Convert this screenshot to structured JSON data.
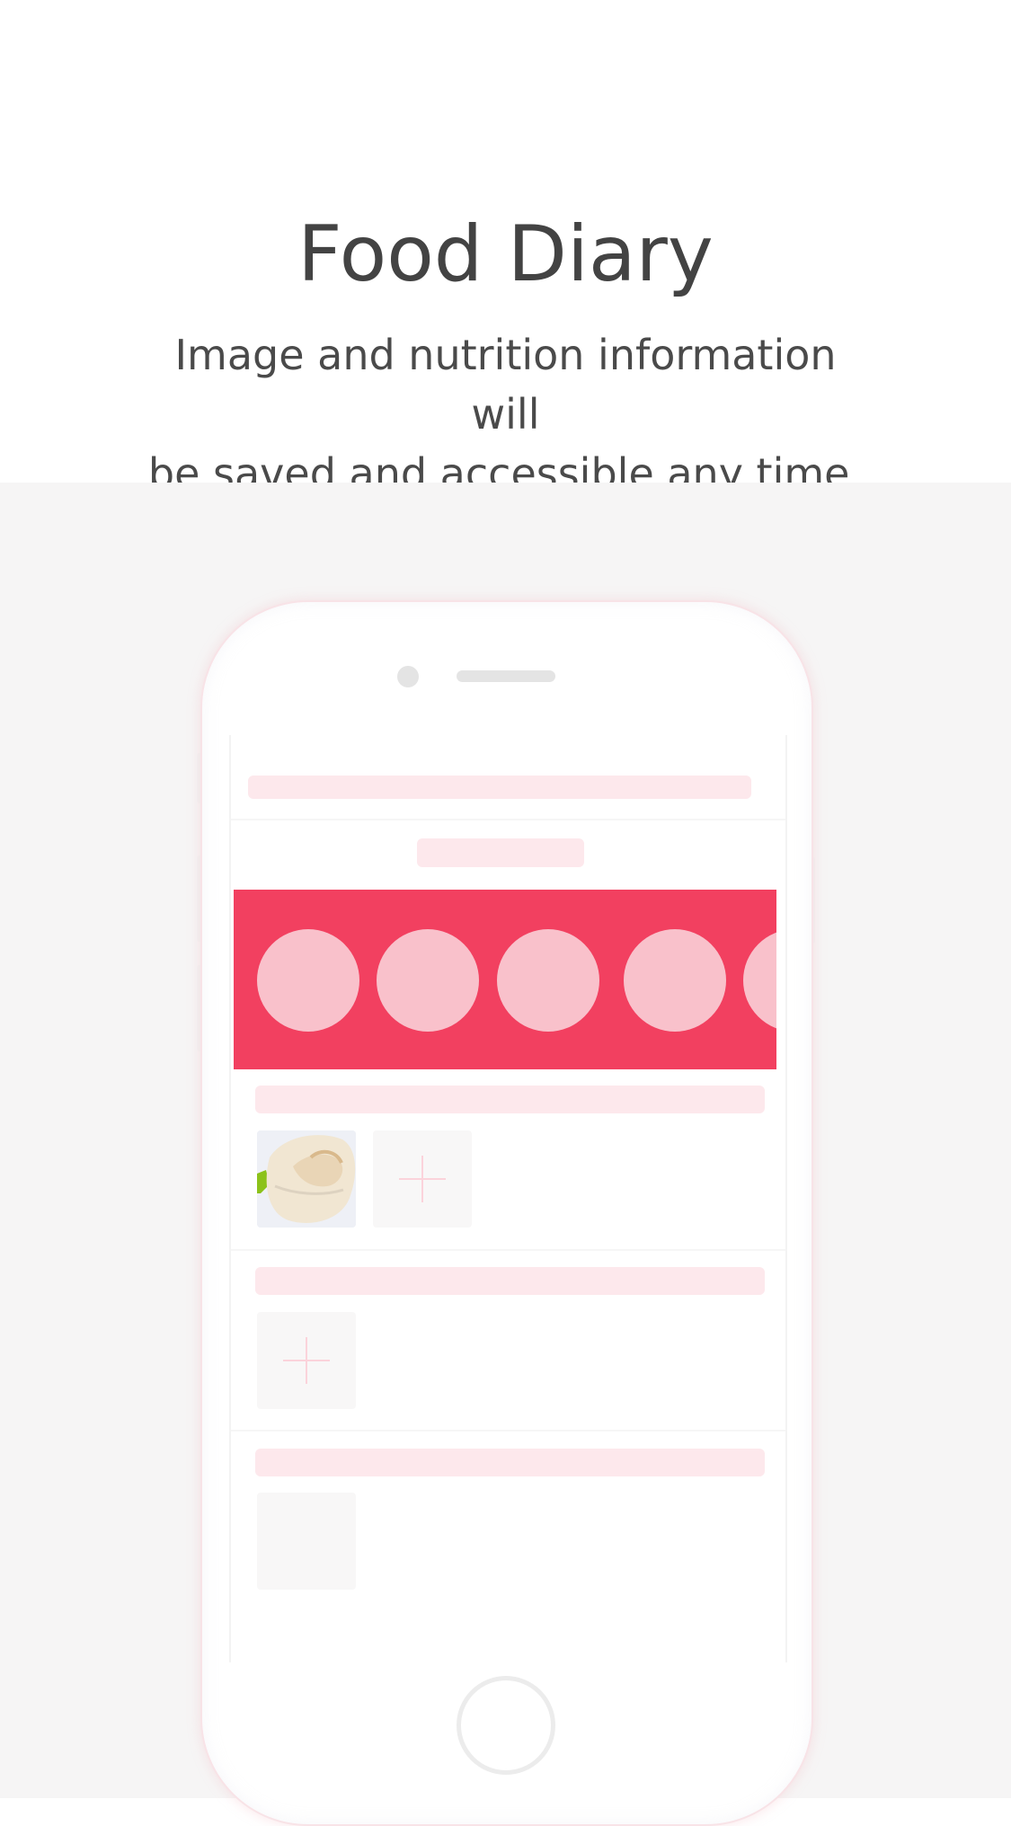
{
  "header": {
    "title": "Food Diary",
    "subtitle_line1": "Image and nutrition information will",
    "subtitle_line2": "be saved and accessible any time."
  },
  "colors": {
    "accent": "#f24060",
    "placeholder_pink": "#fde8ec",
    "circle_pink": "#f9c1cb",
    "page_gray": "#f6f5f5",
    "title_text": "#434343"
  },
  "phone_mockup": {
    "banner_circle_count": 5,
    "sections": [
      {
        "tiles": [
          "food-photo",
          "add-photo"
        ]
      },
      {
        "tiles": [
          "add-photo"
        ]
      },
      {
        "tiles": [
          "empty"
        ]
      }
    ]
  },
  "icons": [
    "camera-icon",
    "speaker-icon",
    "plus-icon",
    "home-button-icon"
  ]
}
